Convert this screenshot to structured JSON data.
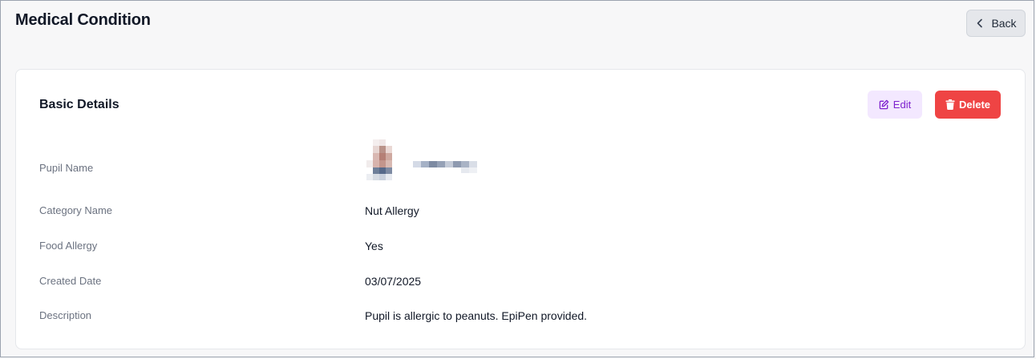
{
  "header": {
    "title": "Medical Condition",
    "back_label": "Back"
  },
  "card": {
    "title": "Basic Details",
    "edit_label": "Edit",
    "delete_label": "Delete"
  },
  "details": {
    "pupil_name": {
      "label": "Pupil Name"
    },
    "category_name": {
      "label": "Category Name",
      "value": "Nut Allergy"
    },
    "food_allergy": {
      "label": "Food Allergy",
      "value": "Yes"
    },
    "created_date": {
      "label": "Created Date",
      "value": "03/07/2025"
    },
    "description": {
      "label": "Description",
      "value": "Pupil is allergic to peanuts. EpiPen provided."
    }
  },
  "colors": {
    "delete": "#ef4444",
    "edit_bg": "#f3e8ff",
    "edit_text": "#7e22ce"
  },
  "icons": {
    "back": "chevron-left-icon",
    "edit": "pencil-square-icon",
    "delete": "trash-icon"
  }
}
